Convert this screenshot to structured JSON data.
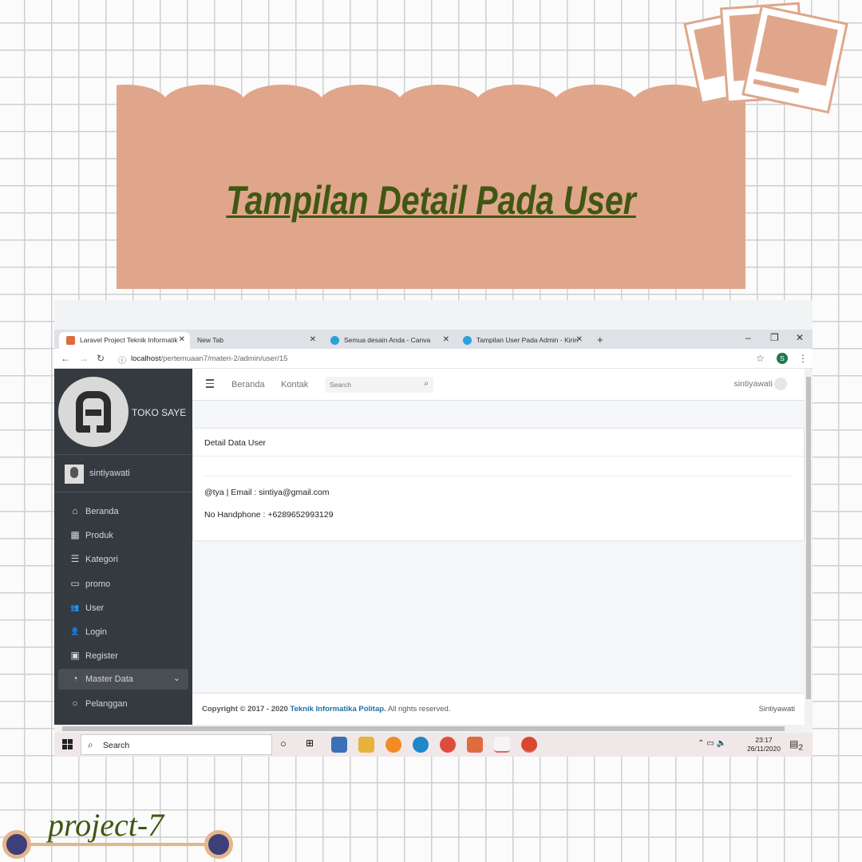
{
  "poster": {
    "title": "Tampilan  Detail Pada User",
    "project_label": "project-7",
    "colors": {
      "accent": "#dfa68b",
      "title": "#3f5712",
      "dot": "#3d3f7a"
    }
  },
  "browser": {
    "tabs": [
      {
        "label": "Laravel Project Teknik Informatik",
        "icon": "xampp-icon",
        "active": true
      },
      {
        "label": "New Tab",
        "icon": "",
        "active": false
      },
      {
        "label": "Semua desain Anda - Canva",
        "icon": "canva-icon",
        "active": false
      },
      {
        "label": "Tampilan User Pada Admin - Kirin",
        "icon": "canva-icon",
        "active": false
      }
    ],
    "new_tab": "+",
    "controls": {
      "minimize": "–",
      "maximize": "❐",
      "close": "✕"
    },
    "url_host": "localhost",
    "url_path": "/pertemuaan7/materi-2/admin/user/15",
    "profile_initial": "S"
  },
  "sidebar": {
    "brand": "TOKO SAYE",
    "user": "sintiyawati",
    "items": [
      {
        "label": "Beranda",
        "icon": "home-icon",
        "glyph": "⌂"
      },
      {
        "label": "Produk",
        "icon": "grid-icon",
        "glyph": "▦"
      },
      {
        "label": "Kategori",
        "icon": "list-icon",
        "glyph": "☰"
      },
      {
        "label": "promo",
        "icon": "card-icon",
        "glyph": "▭"
      },
      {
        "label": "User",
        "icon": "users-icon",
        "glyph": "👥"
      },
      {
        "label": "Login",
        "icon": "user-icon",
        "glyph": "👤"
      },
      {
        "label": "Register",
        "icon": "id-card-icon",
        "glyph": "▣"
      },
      {
        "label": "Master Data",
        "icon": "dashboard-icon",
        "glyph": "◔",
        "active": true,
        "chevron": "⌄"
      },
      {
        "label": "Pelanggan",
        "icon": "circle-icon",
        "glyph": "○"
      }
    ]
  },
  "topnav": {
    "links": [
      "Beranda",
      "Kontak"
    ],
    "search_placeholder": "Search",
    "user": "sintiyawati"
  },
  "card": {
    "title": "Detail Data User",
    "line1": "@tya | Email : sintiya@gmail.com",
    "line2": "No Handphone : +6289652993129"
  },
  "footer": {
    "copy_prefix": "Copyright © 2017 - 2020",
    "org": "Teknik Informatika Politap.",
    "suffix": "All rights reserved.",
    "right": "Sintiyawati"
  },
  "taskbar": {
    "search": "Search",
    "time": "23:17",
    "date": "26/11/2020",
    "notif_count": "2"
  }
}
